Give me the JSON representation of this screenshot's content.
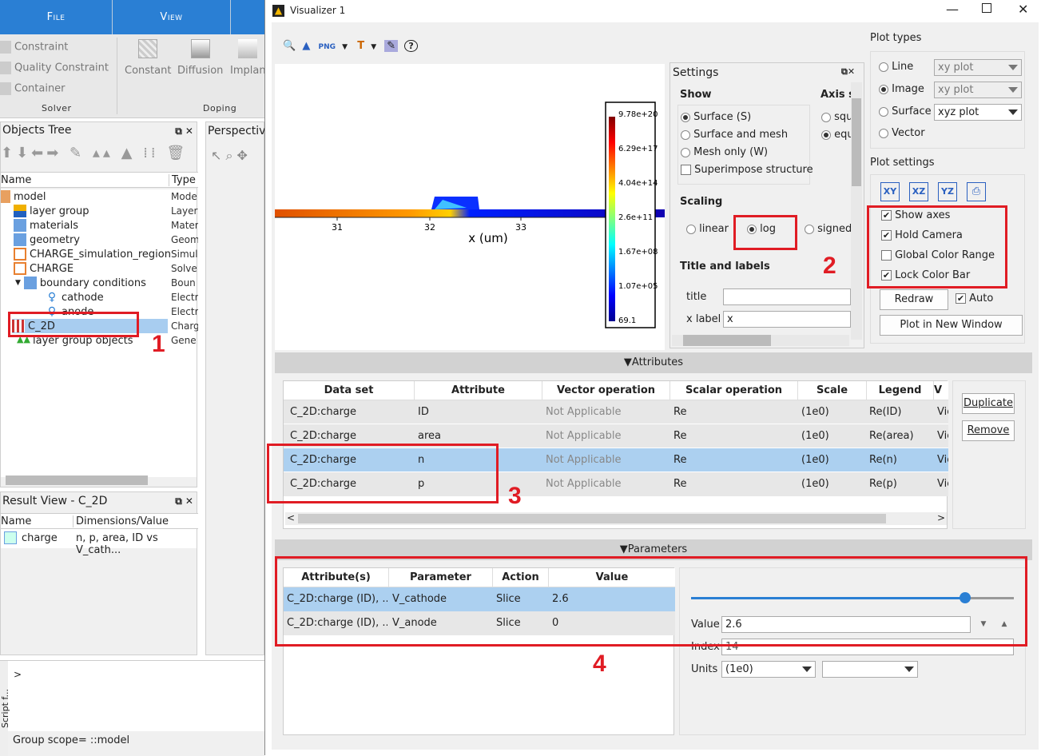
{
  "ribbon": {
    "tabs": [
      "File",
      "View"
    ],
    "solver_items": [
      "Constraint",
      "Quality Constraint",
      "Container"
    ],
    "solver_group": "Solver",
    "doping_items": [
      "Constant",
      "Diffusion",
      "Implan"
    ],
    "doping_group": "Doping"
  },
  "objects_tree": {
    "title": "Objects Tree",
    "col_name": "Name",
    "col_type": "Type",
    "rows": [
      {
        "name": "model",
        "type": "Mode"
      },
      {
        "name": "layer group",
        "type": "Layer"
      },
      {
        "name": "materials",
        "type": "Mater"
      },
      {
        "name": "geometry",
        "type": "Geom"
      },
      {
        "name": "CHARGE_simulation_region",
        "type": "Simul"
      },
      {
        "name": "CHARGE",
        "type": "Solve"
      },
      {
        "name": "boundary conditions",
        "type": "Boun"
      },
      {
        "name": "cathode",
        "type": "Electr"
      },
      {
        "name": "anode",
        "type": "Electr"
      },
      {
        "name": "C_2D",
        "type": "Charg"
      },
      {
        "name": "layer group objects",
        "type": "Gene"
      }
    ]
  },
  "perspective": {
    "title": "Perspectiv"
  },
  "result_view": {
    "title": "Result View - C_2D",
    "col_name": "Name",
    "col_dims": "Dimensions/Value",
    "row_name": "charge",
    "row_dims": "n, p, area, ID vs V_cath..."
  },
  "script": {
    "prompt": ">",
    "side_label": "Script f...",
    "status": "Group scope= ::model"
  },
  "annotations": [
    "1",
    "2",
    "3",
    "4"
  ],
  "visualizer": {
    "title": "Visualizer 1",
    "plot": {
      "x_label": "x (um)",
      "x_ticks": [
        "31",
        "32",
        "33"
      ],
      "colorbar_ticks": [
        "9.78e+20",
        "6.29e+17",
        "4.04e+14",
        "2.6e+11",
        "1.67e+08",
        "1.07e+05",
        "69.1"
      ]
    },
    "settings": {
      "title": "Settings",
      "show_label": "Show",
      "show_options": [
        {
          "label": "Surface (S)",
          "selected": true
        },
        {
          "label": "Surface and mesh",
          "selected": false
        },
        {
          "label": "Mesh only (W)",
          "selected": false
        }
      ],
      "superimpose": "Superimpose structure",
      "axis_label": "Axis sc",
      "axis_options": [
        "squ",
        "equ"
      ],
      "scaling_label": "Scaling",
      "scaling_options": [
        "linear",
        "log",
        "signed"
      ],
      "scaling_selected": "log",
      "title_labels": "Title and labels",
      "title_field_label": "title",
      "title_value": "",
      "xlabel_field_label": "x label",
      "xlabel_value": "x"
    },
    "plot_types": {
      "title": "Plot types",
      "items": [
        {
          "label": "Line",
          "combo": "xy plot",
          "selected": false,
          "enabled": false
        },
        {
          "label": "Image",
          "combo": "xy plot",
          "selected": true,
          "enabled": false
        },
        {
          "label": "Surface",
          "combo": "xyz plot",
          "selected": false,
          "enabled": true
        },
        {
          "label": "Vector",
          "combo": "",
          "selected": false,
          "enabled": false
        }
      ]
    },
    "plot_settings": {
      "title": "Plot settings",
      "view_buttons": [
        "XY",
        "XZ",
        "YZ"
      ],
      "checks": [
        {
          "label": "Show axes",
          "checked": true
        },
        {
          "label": "Hold Camera",
          "checked": true
        },
        {
          "label": "Global Color Range",
          "checked": false
        },
        {
          "label": "Lock Color Bar",
          "checked": true
        }
      ],
      "redraw": "Redraw",
      "auto": "Auto",
      "auto_checked": true,
      "new_window": "Plot in New Window"
    },
    "attributes": {
      "title": "Attributes",
      "headers": [
        "Data set",
        "Attribute",
        "Vector operation",
        "Scalar operation",
        "Scale",
        "Legend",
        "V"
      ],
      "rows": [
        [
          "C_2D:charge",
          "ID",
          "Not Applicable",
          "Re",
          "(1e0)",
          "Re(ID)",
          "Vie"
        ],
        [
          "C_2D:charge",
          "area",
          "Not Applicable",
          "Re",
          "(1e0)",
          "Re(area)",
          "Vie"
        ],
        [
          "C_2D:charge",
          "n",
          "Not Applicable",
          "Re",
          "(1e0)",
          "Re(n)",
          "Vie"
        ],
        [
          "C_2D:charge",
          "p",
          "Not Applicable",
          "Re",
          "(1e0)",
          "Re(p)",
          "Vie"
        ]
      ],
      "selected_row": 2,
      "duplicate": "Duplicate",
      "remove": "Remove"
    },
    "parameters": {
      "title": "Parameters",
      "headers": [
        "Attribute(s)",
        "Parameter",
        "Action",
        "Value"
      ],
      "rows": [
        [
          "C_2D:charge (ID), ...",
          "V_cathode",
          "Slice",
          "2.6"
        ],
        [
          "C_2D:charge (ID), ...",
          "V_anode",
          "Slice",
          "0"
        ]
      ],
      "slider_fraction": 0.85,
      "value_label": "Value",
      "value": "2.6",
      "index_label": "Index",
      "index_value": "14",
      "units_label": "Units",
      "units_value": "(1e0)",
      "units_value2": ""
    }
  }
}
